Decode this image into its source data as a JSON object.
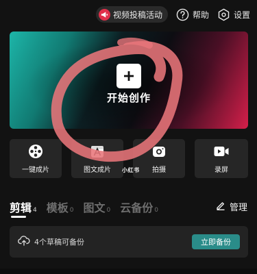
{
  "topbar": {
    "promo_label": "视频投稿活动",
    "help_label": "帮助",
    "settings_label": "设置"
  },
  "hero": {
    "create_label": "开始创作"
  },
  "tools": [
    {
      "label": "一键成片",
      "icon": "film-reel-icon"
    },
    {
      "label": "图文成片",
      "icon": "image-text-icon"
    },
    {
      "label": "拍摄",
      "icon": "camera-icon"
    },
    {
      "label": "录屏",
      "icon": "screen-record-icon"
    }
  ],
  "watermark": "小红书",
  "tabs": [
    {
      "name": "剪辑",
      "count": "4",
      "active": true
    },
    {
      "name": "模板",
      "count": "0",
      "active": false
    },
    {
      "name": "图文",
      "count": "0",
      "active": false
    },
    {
      "name": "云备份",
      "count": "0",
      "active": false
    }
  ],
  "manage_label": "管理",
  "drafts": {
    "text": "4个草稿可备份",
    "button_label": "立即备份"
  },
  "colors": {
    "accent_teal": "#2a8c89",
    "promo_red": "#e0304a",
    "scribble": "#e8757a"
  }
}
